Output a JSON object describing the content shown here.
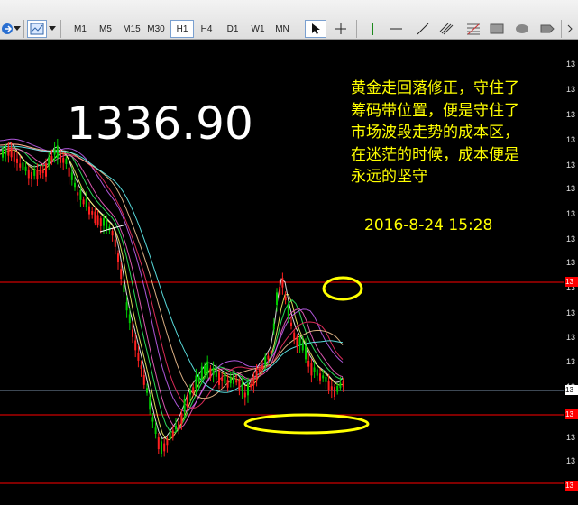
{
  "toolbar": {
    "timeframes": [
      "M1",
      "M5",
      "M15",
      "M30",
      "H1",
      "H4",
      "D1",
      "W1",
      "MN"
    ],
    "active_timeframe": "H1",
    "tools": [
      "cursor-icon",
      "crosshair-icon",
      "vertical-line-icon",
      "horizontal-line-icon",
      "trend-line-icon",
      "channel-icon",
      "fibonacci-icon",
      "rectangle-icon",
      "ellipse-icon",
      "label-icon"
    ]
  },
  "chart": {
    "current_price": "1336.90",
    "note": "黄金走回落修正，守住了筹码带位置，便是守住了市场波段走势的成本区，在迷茫的时候，成本便是永远的坚守",
    "stamp": "2016-8-24  15:28",
    "axis_digit": "13",
    "price_tag_label": "13",
    "colors": {
      "background": "#000000",
      "bull_candle": "#00cc00",
      "bear_candle": "#ff2020",
      "note_text": "#ffff00",
      "level_line": "#ff0000",
      "price_line": "#7a8fa8",
      "ellipse": "#ffff00"
    }
  }
}
